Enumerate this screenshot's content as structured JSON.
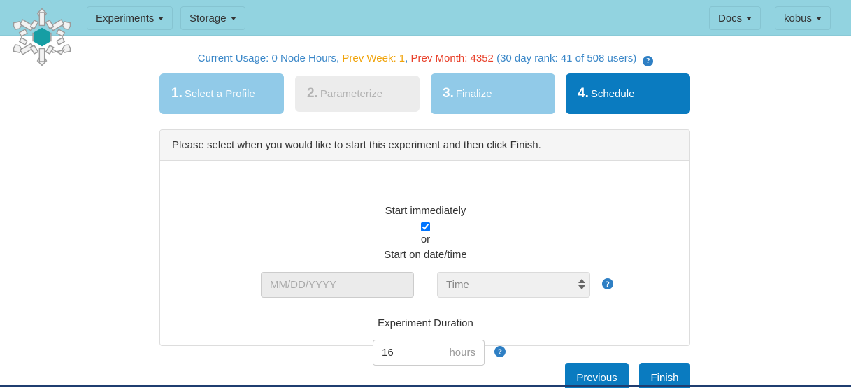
{
  "navbar": {
    "logo_name": "snowflake-logo",
    "left_items": [
      {
        "label": "Experiments",
        "has_caret": true
      },
      {
        "label": "Storage",
        "has_caret": true
      }
    ],
    "right_items": [
      {
        "label": "Docs",
        "has_caret": true
      },
      {
        "label": "kobus",
        "has_caret": true
      }
    ],
    "background_color": "#92d3e0"
  },
  "usage": {
    "current": "Current Usage: 0 Node Hours,",
    "prev_week": "Prev Week: 1",
    "comma": ",",
    "prev_month": "Prev Month: 4352",
    "rank": "(30 day rank: 41 of 508 users)",
    "help_icon": "question-circle-icon",
    "colors": {
      "base": "#3a87c8",
      "week": "#f0a30a",
      "month": "#e8402a"
    }
  },
  "steps": [
    {
      "num": "1.",
      "label": "Select a Profile",
      "state": "completed"
    },
    {
      "num": "2.",
      "label": "Parameterize",
      "state": "disabled"
    },
    {
      "num": "3.",
      "label": "Finalize",
      "state": "completed"
    },
    {
      "num": "4.",
      "label": "Schedule",
      "state": "active"
    }
  ],
  "panel": {
    "header": "Please select when you would like to start this experiment and then click Finish.",
    "start_immediately_label": "Start immediately",
    "start_immediately_checked": true,
    "or_label": "or",
    "start_on_datetime_label": "Start on date/time",
    "date_placeholder": "MM/DD/YYYY",
    "date_value": "",
    "time_selected": "Time",
    "time_options": [
      "Time"
    ],
    "datetime_help_icon": "question-circle-icon",
    "duration_label": "Experiment Duration",
    "duration_value": "16",
    "duration_unit": "hours",
    "duration_help_icon": "question-circle-icon"
  },
  "footer": {
    "previous_label": "Previous",
    "finish_label": "Finish",
    "button_color": "#0a7bc0"
  }
}
